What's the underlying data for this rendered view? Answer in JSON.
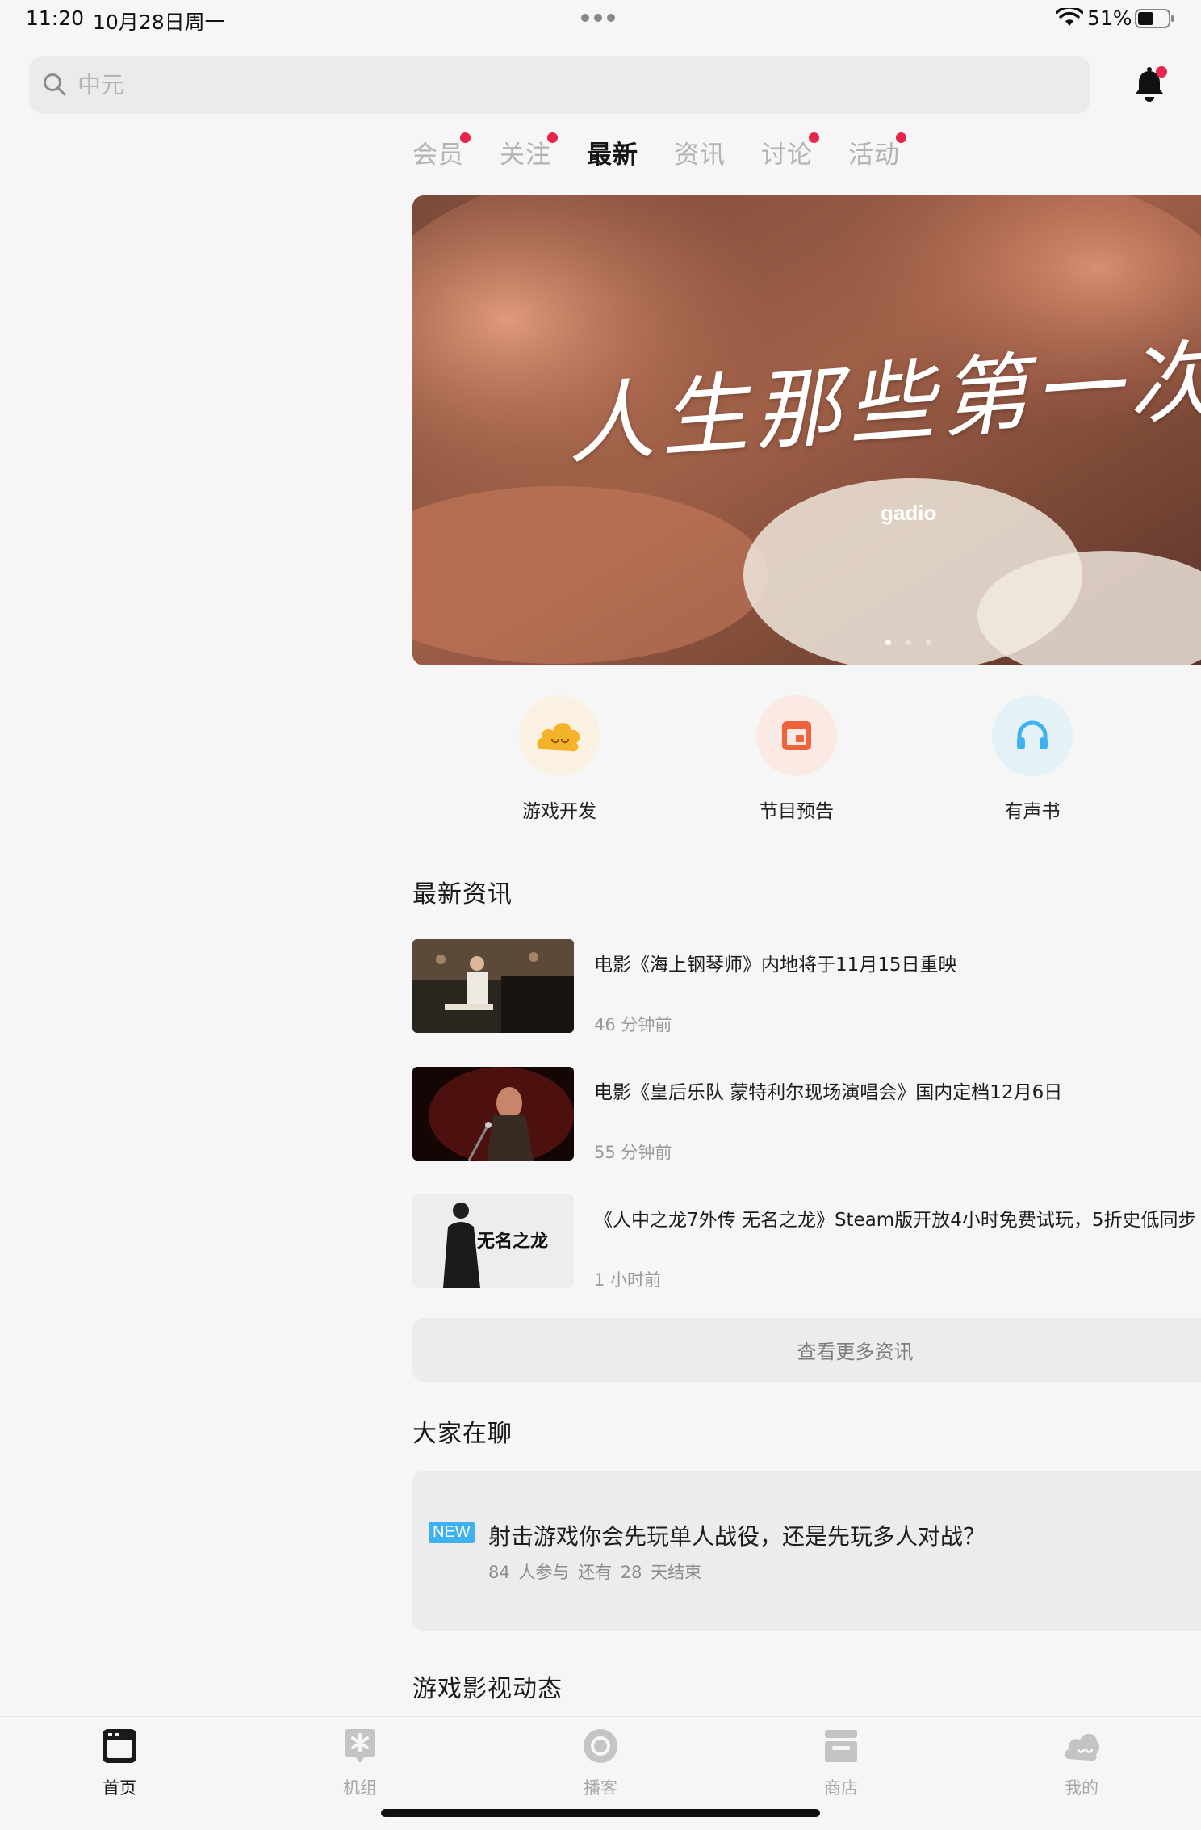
{
  "status_bar": {
    "time": "11:20",
    "date": "10月28日周一",
    "battery": "51%"
  },
  "search": {
    "placeholder": "中元"
  },
  "tabs": [
    {
      "label": "会员",
      "dot": true
    },
    {
      "label": "关注",
      "dot": true
    },
    {
      "label": "最新",
      "dot": false,
      "active": true
    },
    {
      "label": "资讯",
      "dot": false
    },
    {
      "label": "讨论",
      "dot": true
    },
    {
      "label": "活动",
      "dot": true
    }
  ],
  "banner": {
    "title": "人生那些第一次",
    "logo": "gadio",
    "page_count": 3,
    "current_page": 1
  },
  "shortcuts": [
    {
      "label": "游戏开发",
      "icon": "cloud-face-icon",
      "bg": "#fbf1e2",
      "color": "#f5b32a"
    },
    {
      "label": "节目预告",
      "icon": "calendar-icon",
      "bg": "#fbe9e4",
      "color": "#f0623b"
    },
    {
      "label": "有声书",
      "icon": "headphones-icon",
      "bg": "#e4f2f7",
      "color": "#3fb0f0"
    }
  ],
  "sections": {
    "news_title": "最新资讯",
    "chat_title": "大家在聊",
    "video_title": "游戏影视动态"
  },
  "news": [
    {
      "title": "电影《海上钢琴师》内地将于11月15日重映",
      "time": "46 分钟前",
      "thumb": "pianist-thumbnail"
    },
    {
      "title": "电影《皇后乐队 蒙特利尔现场演唱会》国内定档12月6日",
      "time": "55 分钟前",
      "thumb": "concert-thumbnail"
    },
    {
      "title": "《人中之龙7外传 无名之龙》Steam版开放4小时免费试玩，5折史低同步",
      "time": "1 小时前",
      "thumb": "game-thumbnail",
      "thumb_text": "无名之龙"
    }
  ],
  "more_news_label": "查看更多资讯",
  "discussion": {
    "badge": "NEW",
    "title": "射击游戏你会先玩单人战役，还是先玩多人对战？",
    "meta": "84 人参与  还有 28 天结束"
  },
  "tabbar": [
    {
      "label": "首页",
      "icon": "home-icon",
      "active": true
    },
    {
      "label": "机组",
      "icon": "crew-icon",
      "active": false
    },
    {
      "label": "播客",
      "icon": "podcast-icon",
      "active": false
    },
    {
      "label": "商店",
      "icon": "store-icon",
      "active": false
    },
    {
      "label": "我的",
      "icon": "profile-icon",
      "active": false
    }
  ],
  "colors": {
    "accent_dot": "#e8254b",
    "new_badge": "#3fb0f0",
    "active_text": "#161616",
    "inactive_text": "#b3b3b3"
  }
}
